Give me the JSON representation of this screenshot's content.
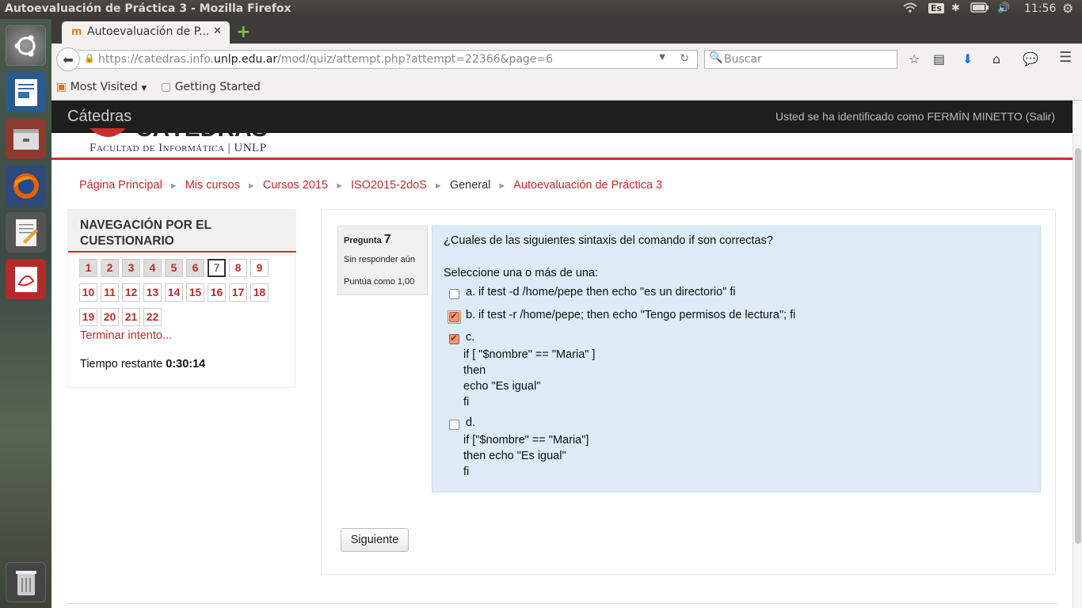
{
  "window": {
    "title": "Autoevaluación de Práctica 3 - Mozilla Firefox"
  },
  "system": {
    "keyboard": "Es",
    "clock": "11:56"
  },
  "browser": {
    "tab_title": "Autoevaluación de P...",
    "url_prefix": "https://catedras.info.",
    "url_domain": "unlp.edu.ar",
    "url_rest": "/mod/quiz/attempt.php?attempt=22366&page=6",
    "search_placeholder": "Buscar",
    "bookmarks": {
      "most_visited": "Most Visited",
      "getting_started": "Getting Started"
    }
  },
  "site": {
    "brand": "Cátedras",
    "login_text": "Usted se ha identificado como FERMÍN MINETTO (Salir)",
    "logo_text": "Facultad de Informática | UNLP"
  },
  "breadcrumb": {
    "items": [
      "Página Principal",
      "Mis cursos",
      "Cursos 2015",
      "ISO2015-2doS",
      "General",
      "Autoevaluación de Práctica 3"
    ],
    "current_index": 4
  },
  "quiz_nav": {
    "title_line1": "NAVEGACIÓN POR EL",
    "title_line2": "CUESTIONARIO",
    "questions": [
      "1",
      "2",
      "3",
      "4",
      "5",
      "6",
      "7",
      "8",
      "9",
      "10",
      "11",
      "12",
      "13",
      "14",
      "15",
      "16",
      "17",
      "18",
      "19",
      "20",
      "21",
      "22"
    ],
    "current": "7",
    "finish_link": "Terminar intento...",
    "timer_label": "Tiempo restante",
    "timer_value": "0:30:14"
  },
  "question": {
    "label": "Pregunta",
    "number": "7",
    "state": "Sin responder aún",
    "grade": "Puntúa como 1,00",
    "text": "¿Cuales de las siguientes sintaxis del comando if son correctas?",
    "prompt": "Seleccione una o más de una:",
    "answers": [
      {
        "letter": "a.",
        "text": "if test -d /home/pepe then echo \"es un directorio\" fi",
        "checked": false
      },
      {
        "letter": "b.",
        "text": "if test -r /home/pepe; then echo \"Tengo permisos de lectura\"; fi",
        "checked": true
      },
      {
        "letter": "c.",
        "lines": [
          "if [ \"$nombre\" == \"Maria\" ]",
          "then",
          "echo \"Es igual\"",
          "fi"
        ],
        "checked": true
      },
      {
        "letter": "d.",
        "lines": [
          "if [\"$nombre\" == \"Maria\"]",
          "then echo \"Es igual\"",
          "fi"
        ],
        "checked": false
      }
    ]
  },
  "buttons": {
    "next": "Siguiente"
  },
  "colors": {
    "accent": "#c9302c",
    "question_bg": "#dcebf5",
    "topbar": "#1e1e1e"
  }
}
